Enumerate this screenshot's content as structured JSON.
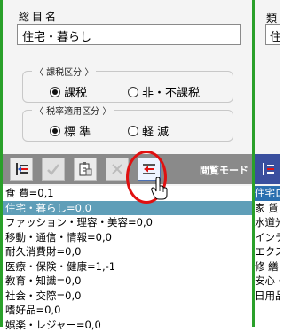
{
  "item_name": {
    "label": "総目名",
    "value": "住宅・暮らし"
  },
  "tax_category": {
    "legend": "〈 課税区分 〉",
    "options": [
      {
        "label": "課税",
        "selected": true
      },
      {
        "label": "非・不課税",
        "selected": false
      }
    ]
  },
  "tax_rate": {
    "legend": "〈 税率適用区分 〉",
    "options": [
      {
        "label": "標 準",
        "selected": true
      },
      {
        "label": "軽 減",
        "selected": false
      }
    ]
  },
  "toolbar": {
    "mode_label": "閲覧モード",
    "icons": [
      "add-row-icon",
      "check-icon",
      "clipboard-icon",
      "delete-icon",
      "back-arrow-icon"
    ]
  },
  "list": {
    "items": [
      "食 費=0,1",
      "住宅・暮らし=0,0",
      "ファッション・理容・美容=0,0",
      "移動・通信・情報=0,0",
      "耐久消費財=0,0",
      "医療・保険・健康=1,-1",
      "教育・知識=0,0",
      "社会・交際=0,0",
      "嗜好品=0,0",
      "娯楽・レジャー=0,0"
    ],
    "selected_index": 1
  },
  "right_panel": {
    "label": "類",
    "field_value": "住",
    "items": [
      "住宅ロ",
      "家 賃",
      "水道光",
      "インテリ",
      "エクステ",
      "修 繕",
      "安心・",
      "日用品",
      ""
    ]
  },
  "colors": {
    "accent_green": "#2aa02a",
    "selection": "#5f9eb8",
    "annotation_red": "#e01010",
    "toolbar_gray": "#8a8a8a",
    "toolbar_blue": "#3a4f9e"
  }
}
